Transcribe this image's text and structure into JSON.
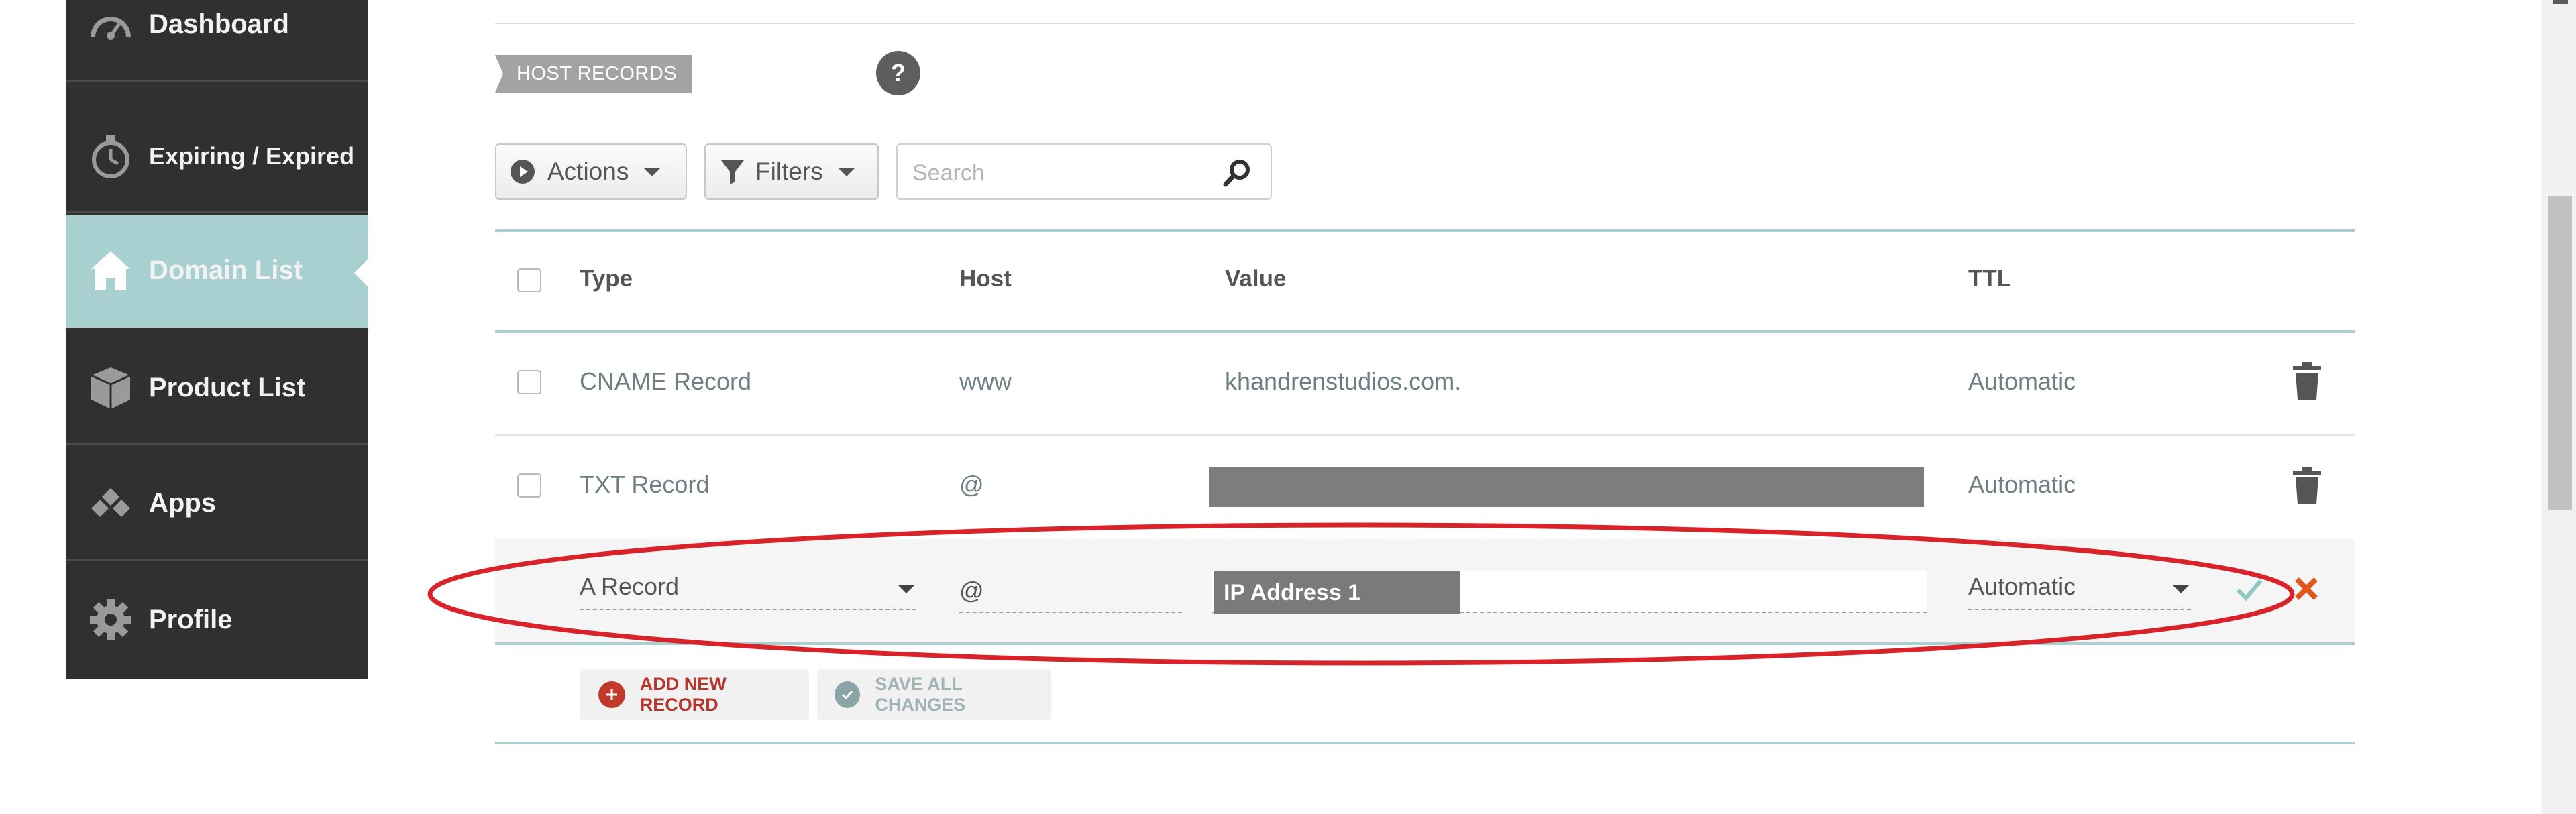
{
  "sidebar": {
    "items": [
      {
        "label": "Dashboard",
        "icon": "speedometer-icon"
      },
      {
        "label": "Expiring / Expired",
        "icon": "stopwatch-icon"
      },
      {
        "label": "Domain List",
        "icon": "home-icon",
        "active": true
      },
      {
        "label": "Product List",
        "icon": "box-icon"
      },
      {
        "label": "Apps",
        "icon": "apps-icon"
      },
      {
        "label": "Profile",
        "icon": "gear-icon"
      }
    ]
  },
  "section": {
    "title": "HOST RECORDS",
    "help": "?"
  },
  "toolbar": {
    "actions_label": "Actions",
    "filters_label": "Filters",
    "search_placeholder": "Search"
  },
  "table": {
    "headers": {
      "type": "Type",
      "host": "Host",
      "value": "Value",
      "ttl": "TTL"
    },
    "rows": [
      {
        "type": "CNAME Record",
        "host": "www",
        "value": "khandrenstudios.com.",
        "ttl": "Automatic"
      },
      {
        "type": "TXT Record",
        "host": "@",
        "value": "",
        "ttl": "Automatic",
        "value_redacted": true
      }
    ],
    "edit_row": {
      "type": "A Record",
      "host": "@",
      "value": "IP Address 1",
      "ttl": "Automatic"
    }
  },
  "footer_actions": {
    "add_label": "ADD NEW RECORD",
    "save_label": "SAVE ALL CHANGES"
  },
  "colors": {
    "sidebar_bg": "#303030",
    "active_nav": "#a8d0d0",
    "accent_line": "#a9cfcf",
    "add_red": "#c0392b",
    "cancel_orange": "#e0561b",
    "ok_green": "#8fc6c0",
    "highlight_ellipse": "#d8232a"
  }
}
